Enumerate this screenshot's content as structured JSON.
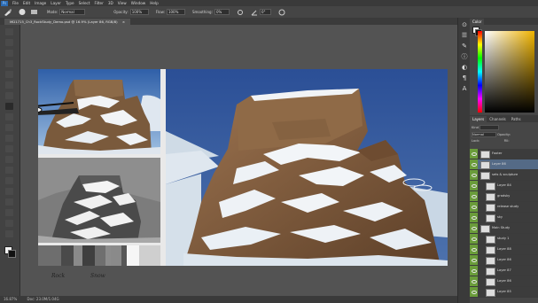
{
  "menu": {
    "items": [
      "File",
      "Edit",
      "Image",
      "Layer",
      "Type",
      "Select",
      "Filter",
      "3D",
      "View",
      "Window",
      "Help"
    ]
  },
  "options": {
    "mode_label": "Mode:",
    "mode_value": "Normal",
    "opacity_label": "Opacity:",
    "opacity_value": "100%",
    "flow_label": "Flow:",
    "flow_value": "100%",
    "smoothing_label": "Smoothing:",
    "smoothing_value": "0%",
    "angle_value": "0°"
  },
  "document": {
    "tab_title": "MD1715_Ch3_RockStudy_Demo.psd @ 16.9% (Layer 86, RGB/8)",
    "status_zoom": "16.87%",
    "status_doc": "Doc: 23.0M/1.04G"
  },
  "canvas": {
    "label_rock": "Rock",
    "label_snow": "Snow"
  },
  "panels": {
    "color_tab": "Color",
    "layers_tabs": [
      "Layers",
      "Channels",
      "Paths"
    ],
    "kind_label": "Kind",
    "blend_value": "Normal",
    "opacity_label": "Opacity:",
    "fill_label": "Fill:",
    "lock_label": "Lock:"
  },
  "layers": [
    {
      "name": "Footer",
      "eye": true,
      "color": "#3c3c3c"
    },
    {
      "name": "Layer 86",
      "eye": true,
      "color": "#546a86"
    },
    {
      "name": "sets & sculpture",
      "eye": true,
      "color": "#3c3c3c"
    },
    {
      "name": "Layer 84",
      "eye": true,
      "color": "#3c3c3c"
    },
    {
      "name": "gradsky",
      "eye": true,
      "color": "#3c3c3c"
    },
    {
      "name": "release study",
      "eye": true,
      "color": "#3c3c3c"
    },
    {
      "name": "sky",
      "eye": true,
      "color": "#3c3c3c"
    },
    {
      "name": "Main Study",
      "eye": true,
      "color": "#3c3c3c"
    },
    {
      "name": "study 1",
      "eye": true,
      "color": "#3c3c3c"
    },
    {
      "name": "Layer 88",
      "eye": true,
      "color": "#3c3c3c"
    },
    {
      "name": "Layer 86",
      "eye": true,
      "color": "#3c3c3c"
    },
    {
      "name": "Layer 87",
      "eye": true,
      "color": "#3c3c3c"
    },
    {
      "name": "Layer 86",
      "eye": true,
      "color": "#3c3c3c"
    },
    {
      "name": "Layer 85",
      "eye": true,
      "color": "#3c3c3c"
    }
  ],
  "colors": {
    "accent_eye_column": "#6a9c3a",
    "layer_selected": "#5a6a80"
  }
}
